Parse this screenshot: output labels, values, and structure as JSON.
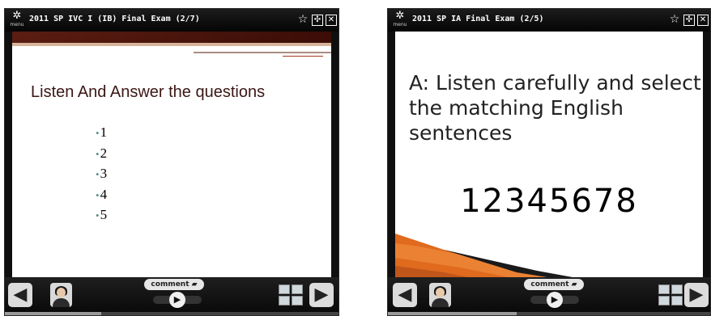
{
  "players": [
    {
      "title": "2011 SP IVC I (IB) Final Exam  (2/7)",
      "menu_label": "menu",
      "slide": {
        "title": "Listen And Answer the questions",
        "items": [
          "1",
          "2",
          "3",
          "4",
          "5"
        ]
      },
      "comment_label": "comment",
      "progress": 0.29
    },
    {
      "title": "2011 SP IA Final Exam (2/5)",
      "menu_label": "menu",
      "slide": {
        "text": "A: Listen carefully and select the matching English sentences",
        "number": "12345678"
      },
      "comment_label": "comment",
      "progress": 0.4
    }
  ],
  "icons": {
    "menu": "gear-icon",
    "favorite": "star-icon",
    "resize": "resize-icon",
    "close": "close-icon",
    "prev": "arrow-left-icon",
    "next": "arrow-right-icon",
    "comment": "speech-bubble-icon",
    "play": "play-icon",
    "thumbnails": "thumbnails-icon"
  },
  "colors": {
    "slide1_band": "#5a1d12",
    "slide2_swoosh": "#e06a1e",
    "bullet": "#5a8f8f"
  }
}
